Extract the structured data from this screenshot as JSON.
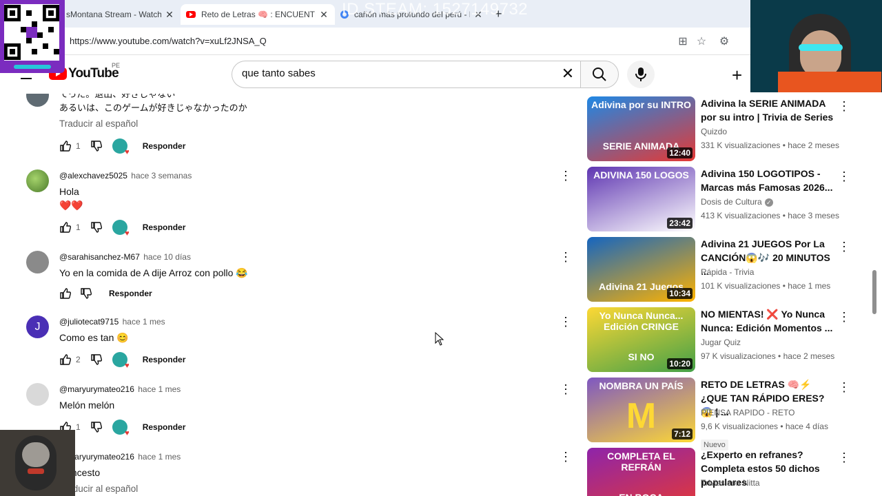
{
  "browser": {
    "tabs": [
      {
        "title": "sMontana Stream - Watch Liv",
        "active": false
      },
      {
        "title": "Reto de Letras 🧠 : ENCUENTRA u",
        "active": true
      },
      {
        "title": "cañón más profundo del perú - Bú",
        "active": false
      }
    ],
    "url": "https://www.youtube.com/watch?v=xuLf2JNSA_Q",
    "overlay_stream_id": "ID STEAM: 1527149732"
  },
  "header": {
    "logo_text": "YouTube",
    "country_code": "PE",
    "search_value": "que tanto sabes"
  },
  "comments": [
    {
      "author": "",
      "time": "",
      "lines": [
        "てった。退出、好きじゃない",
        "あるいは、このゲームが好きじゃなかったのか"
      ],
      "translate": "Traducir al español",
      "likes": "1",
      "reply": "Responder",
      "has_heart": true
    },
    {
      "author": "@alexchavez5025",
      "time": "hace 3 semanas",
      "lines": [
        "Hola",
        "❤️❤️"
      ],
      "translate": "",
      "likes": "1",
      "reply": "Responder",
      "has_heart": true
    },
    {
      "author": "@sarahisanchez-M67",
      "time": "hace 10 días",
      "lines": [
        "Yo en la comida de A dije Arroz con pollo 😂"
      ],
      "translate": "",
      "likes": "",
      "reply": "Responder",
      "has_heart": false
    },
    {
      "author": "@juliotecat9715",
      "time": "hace 1 mes",
      "lines": [
        "Como es tan 😊"
      ],
      "translate": "",
      "likes": "2",
      "reply": "Responder",
      "has_heart": true
    },
    {
      "author": "@maryurymateo216",
      "time": "hace 1 mes",
      "lines": [
        "Melón melón"
      ],
      "translate": "",
      "likes": "1",
      "reply": "Responder",
      "has_heart": true
    },
    {
      "author": "@maryurymateo216",
      "time": "hace 1 mes",
      "lines": [
        "Concesto"
      ],
      "translate": "Traducir al español",
      "likes": "",
      "reply": "",
      "has_heart": false
    }
  ],
  "videos": [
    {
      "title": "Adivina la SERIE ANIMADA por su intro | Trivia de Series",
      "channel": "Quizdo",
      "verified": false,
      "meta": "331 K visualizaciones • hace 2 meses",
      "duration": "12:40",
      "thumb_top": "Adivina por su INTRO",
      "thumb_bottom": "SERIE ANIMADA",
      "colors": [
        "#1e88e5",
        "#e53935"
      ],
      "badge": ""
    },
    {
      "title": "Adivina 150 LOGOTIPOS - Marcas más Famosas 2026...",
      "channel": "Dosis de Cultura",
      "verified": true,
      "meta": "413 K visualizaciones • hace 3 meses",
      "duration": "23:42",
      "thumb_top": "ADIVINA 150 LOGOS",
      "thumb_bottom": "",
      "colors": [
        "#5e35b1",
        "#ffffff"
      ],
      "badge": ""
    },
    {
      "title": "Adivina 21 JUEGOS Por La CANCIÓN😱🎶 20 MINUTOS ...",
      "channel": "Rápida - Trivia",
      "verified": false,
      "meta": "101 K visualizaciones • hace 1 mes",
      "duration": "10:34",
      "thumb_top": "",
      "thumb_bottom": "Adivina 21 Juegos",
      "colors": [
        "#1565c0",
        "#ffb300"
      ],
      "badge": ""
    },
    {
      "title": "NO MIENTAS! ❌ Yo Nunca Nunca: Edición Momentos ...",
      "channel": "Jugar Quiz",
      "verified": false,
      "meta": "97 K visualizaciones • hace 2 meses",
      "duration": "10:20",
      "thumb_top": "Yo Nunca Nunca... Edición CRINGE",
      "thumb_bottom": "SI    NO",
      "colors": [
        "#fdd835",
        "#43a047"
      ],
      "badge": ""
    },
    {
      "title": "RETO DE LETRAS 🧠⚡ ¿QUE TAN RÁPIDO ERES? 😱 | ...",
      "channel": "PIENSA RAPIDO - RETO",
      "verified": false,
      "meta": "9,6 K visualizaciones • hace 4 días",
      "duration": "7:12",
      "thumb_top": "NOMBRA UN PAÍS",
      "thumb_bottom": "M",
      "colors": [
        "#7e57c2",
        "#fdd835"
      ],
      "badge": "Nuevo"
    },
    {
      "title": "¿Experto en refranes? Completa estos 50 dichos populares",
      "channel": "Trivias con Nitta",
      "verified": false,
      "meta": "",
      "duration": "",
      "thumb_top": "COMPLETA EL REFRÁN",
      "thumb_bottom": "EN BOCA",
      "colors": [
        "#8e24aa",
        "#e53935"
      ],
      "badge": ""
    }
  ],
  "accent": {
    "youtube_red": "#ff0000",
    "link_grey": "#606060"
  }
}
